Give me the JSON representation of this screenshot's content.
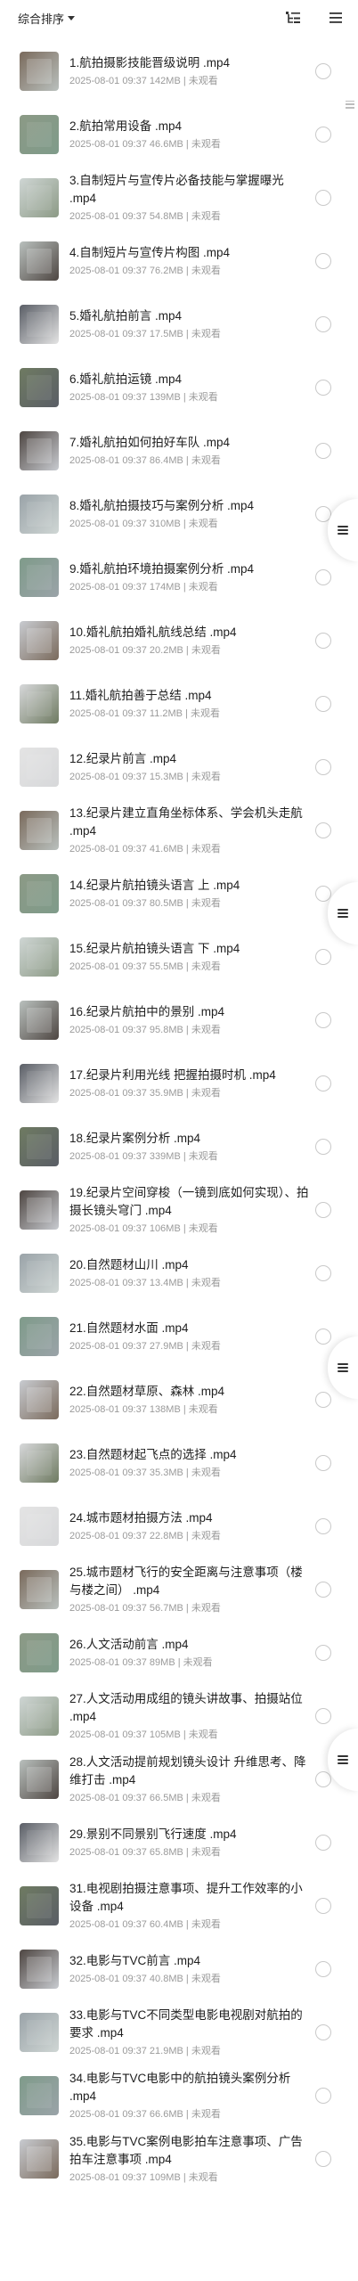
{
  "header": {
    "sort_label": "综合排序",
    "icons": [
      "multi-select-icon",
      "list-view-icon"
    ]
  },
  "files": [
    {
      "title": "1.航拍摄影技能晋级说明 .mp4",
      "date": "2025-08-01 09:37",
      "size": "142MB",
      "status": "未观看"
    },
    {
      "title": "2.航拍常用设备 .mp4",
      "date": "2025-08-01 09:37",
      "size": "46.6MB",
      "status": "未观看"
    },
    {
      "title": "3.自制短片与宣传片必备技能与掌握曝光 .mp4",
      "date": "2025-08-01 09:37",
      "size": "54.8MB",
      "status": "未观看"
    },
    {
      "title": "4.自制短片与宣传片构图 .mp4",
      "date": "2025-08-01 09:37",
      "size": "76.2MB",
      "status": "未观看"
    },
    {
      "title": "5.婚礼航拍前言 .mp4",
      "date": "2025-08-01 09:37",
      "size": "17.5MB",
      "status": "未观看"
    },
    {
      "title": "6.婚礼航拍运镜 .mp4",
      "date": "2025-08-01 09:37",
      "size": "139MB",
      "status": "未观看"
    },
    {
      "title": "7.婚礼航拍如何拍好车队 .mp4",
      "date": "2025-08-01 09:37",
      "size": "86.4MB",
      "status": "未观看"
    },
    {
      "title": "8.婚礼航拍摄技巧与案例分析 .mp4",
      "date": "2025-08-01 09:37",
      "size": "310MB",
      "status": "未观看"
    },
    {
      "title": "9.婚礼航拍环境拍摄案例分析 .mp4",
      "date": "2025-08-01 09:37",
      "size": "174MB",
      "status": "未观看"
    },
    {
      "title": "10.婚礼航拍婚礼航线总结 .mp4",
      "date": "2025-08-01 09:37",
      "size": "20.2MB",
      "status": "未观看"
    },
    {
      "title": "11.婚礼航拍善于总结 .mp4",
      "date": "2025-08-01 09:37",
      "size": "11.2MB",
      "status": "未观看"
    },
    {
      "title": "12.纪录片前言 .mp4",
      "date": "2025-08-01 09:37",
      "size": "15.3MB",
      "status": "未观看"
    },
    {
      "title": "13.纪录片建立直角坐标体系、学会机头走航 .mp4",
      "date": "2025-08-01 09:37",
      "size": "41.6MB",
      "status": "未观看"
    },
    {
      "title": "14.纪录片航拍镜头语言 上 .mp4",
      "date": "2025-08-01 09:37",
      "size": "80.5MB",
      "status": "未观看"
    },
    {
      "title": "15.纪录片航拍镜头语言 下 .mp4",
      "date": "2025-08-01 09:37",
      "size": "55.5MB",
      "status": "未观看"
    },
    {
      "title": "16.纪录片航拍中的景别 .mp4",
      "date": "2025-08-01 09:37",
      "size": "95.8MB",
      "status": "未观看"
    },
    {
      "title": "17.纪录片利用光线 把握拍摄时机 .mp4",
      "date": "2025-08-01 09:37",
      "size": "35.9MB",
      "status": "未观看"
    },
    {
      "title": "18.纪录片案例分析 .mp4",
      "date": "2025-08-01 09:37",
      "size": "339MB",
      "status": "未观看"
    },
    {
      "title": "19.纪录片空间穿梭（一镜到底如何实现）、拍摄长镜头穹门 .mp4",
      "date": "2025-08-01 09:37",
      "size": "106MB",
      "status": "未观看"
    },
    {
      "title": "20.自然题材山川 .mp4",
      "date": "2025-08-01 09:37",
      "size": "13.4MB",
      "status": "未观看"
    },
    {
      "title": "21.自然题材水面 .mp4",
      "date": "2025-08-01 09:37",
      "size": "27.9MB",
      "status": "未观看"
    },
    {
      "title": "22.自然题材草原、森林 .mp4",
      "date": "2025-08-01 09:37",
      "size": "138MB",
      "status": "未观看"
    },
    {
      "title": "23.自然题材起飞点的选择 .mp4",
      "date": "2025-08-01 09:37",
      "size": "35.3MB",
      "status": "未观看"
    },
    {
      "title": "24.城市题材拍摄方法 .mp4",
      "date": "2025-08-01 09:37",
      "size": "22.8MB",
      "status": "未观看"
    },
    {
      "title": "25.城市题材飞行的安全距离与注意事项（楼与楼之间） .mp4",
      "date": "2025-08-01 09:37",
      "size": "56.7MB",
      "status": "未观看"
    },
    {
      "title": "26.人文活动前言 .mp4",
      "date": "2025-08-01 09:37",
      "size": "89MB",
      "status": "未观看"
    },
    {
      "title": "27.人文活动用成组的镜头讲故事、拍摄站位 .mp4",
      "date": "2025-08-01 09:37",
      "size": "105MB",
      "status": "未观看"
    },
    {
      "title": "28.人文活动提前规划镜头设计 升维思考、降维打击 .mp4",
      "date": "2025-08-01 09:37",
      "size": "66.5MB",
      "status": "未观看"
    },
    {
      "title": "29.景别不同景别飞行速度 .mp4",
      "date": "2025-08-01 09:37",
      "size": "65.8MB",
      "status": "未观看"
    },
    {
      "title": "31.电视剧拍摄注意事项、提升工作效率的小设备 .mp4",
      "date": "2025-08-01 09:37",
      "size": "60.4MB",
      "status": "未观看"
    },
    {
      "title": "32.电影与TVC前言 .mp4",
      "date": "2025-08-01 09:37",
      "size": "40.8MB",
      "status": "未观看"
    },
    {
      "title": "33.电影与TVC不同类型电影电视剧对航拍的要求 .mp4",
      "date": "2025-08-01 09:37",
      "size": "21.9MB",
      "status": "未观看"
    },
    {
      "title": "34.电影与TVC电影中的航拍镜头案例分析 .mp4",
      "date": "2025-08-01 09:37",
      "size": "66.6MB",
      "status": "未观看"
    },
    {
      "title": "35.电影与TVC案例电影拍车注意事项、广告拍车注意事项 .mp4",
      "date": "2025-08-01 09:37",
      "size": "109MB",
      "status": "未观看"
    }
  ],
  "colors": {
    "thumb_palette": [
      "#7a6a5c",
      "#8c9a86",
      "#cfd6d4",
      "#b9c0bd",
      "#5a5e66",
      "#6f7b62",
      "#4e4642",
      "#9aa3a8",
      "#7f9b8a",
      "#c8cbd0",
      "#d7d8da",
      "#e4e4e4"
    ]
  }
}
